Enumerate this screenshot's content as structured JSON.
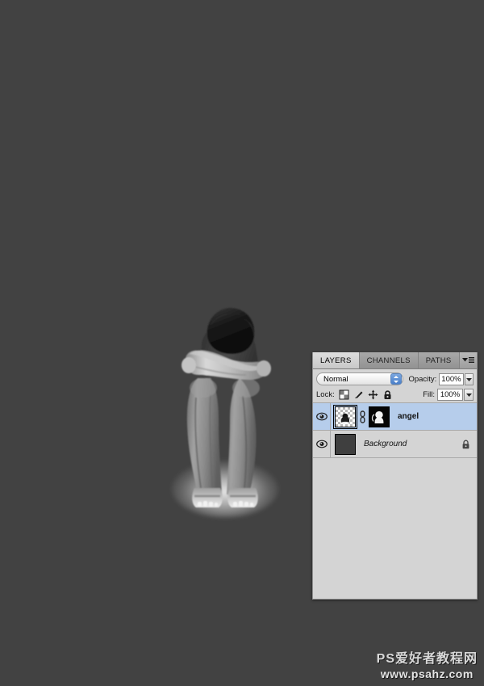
{
  "app": {
    "name": "Adobe Photoshop",
    "canvas_background_color": "#424242"
  },
  "document": {
    "image_description": "Grayscale photo of a person sitting hunched with head buried in crossed arms over knees, wearing sandals, with a soft white glow beneath the feet"
  },
  "layers_panel": {
    "tabs": [
      {
        "label": "LAYERS",
        "active": true
      },
      {
        "label": "CHANNELS",
        "active": false
      },
      {
        "label": "PATHS",
        "active": false
      }
    ],
    "menu_icon": "panel-menu-icon",
    "blend_mode": {
      "label": "",
      "value": "Normal",
      "stepper_color": "#4a7fc9"
    },
    "opacity": {
      "label": "Opacity:",
      "value": "100%"
    },
    "fill": {
      "label": "Fill:",
      "value": "100%"
    },
    "lock": {
      "label": "Lock:",
      "icons": [
        "lock-transparency-icon",
        "lock-image-pixels-icon",
        "lock-position-icon",
        "lock-all-icon"
      ]
    },
    "layers": [
      {
        "name": "angel",
        "selected": true,
        "visible": true,
        "italic": false,
        "has_thumbnail": true,
        "thumbnail_type": "transparent-checker",
        "has_link_icon": true,
        "has_mask": true,
        "locked": false
      },
      {
        "name": "Background",
        "selected": false,
        "visible": true,
        "italic": true,
        "has_thumbnail": true,
        "thumbnail_type": "solid-dark",
        "has_link_icon": false,
        "has_mask": false,
        "locked": true
      }
    ],
    "selected_row_color": "#b6cdeb",
    "panel_background_color": "#d4d4d4"
  },
  "watermark": {
    "site_name": "PS爱好者教程网",
    "url": "www.psahz.com"
  }
}
